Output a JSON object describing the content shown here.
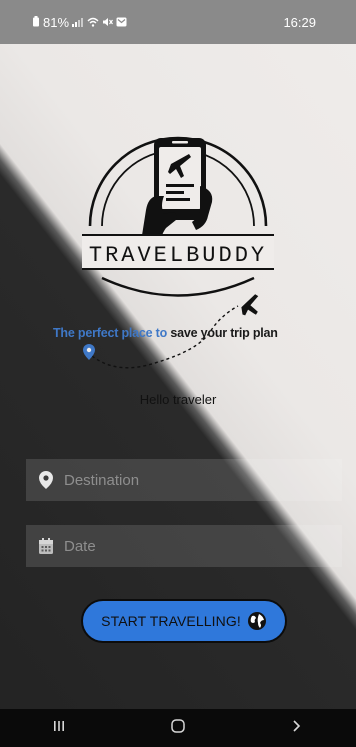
{
  "status_bar": {
    "battery": "81%",
    "time": "16:29"
  },
  "logo": {
    "brand": "TRAVELBUDDY"
  },
  "tagline": {
    "part_blue": "The perfect place to",
    "part_dark": " save your trip plan"
  },
  "greeting": "Hello traveler",
  "form": {
    "destination": {
      "placeholder": "Destination",
      "value": "",
      "icon": "location-pin-icon"
    },
    "date": {
      "placeholder": "Date",
      "value": "",
      "icon": "calendar-icon"
    }
  },
  "start_button": {
    "label": "START TRAVELLING!",
    "icon": "globe-icon"
  },
  "nav_bar": {
    "recent": "recent-apps-icon",
    "home": "home-icon",
    "back": "back-icon"
  },
  "colors": {
    "accent": "#2f78db",
    "tagline_blue": "#3f78c7",
    "dark_bg": "#232323",
    "light_bg": "#efecea"
  }
}
